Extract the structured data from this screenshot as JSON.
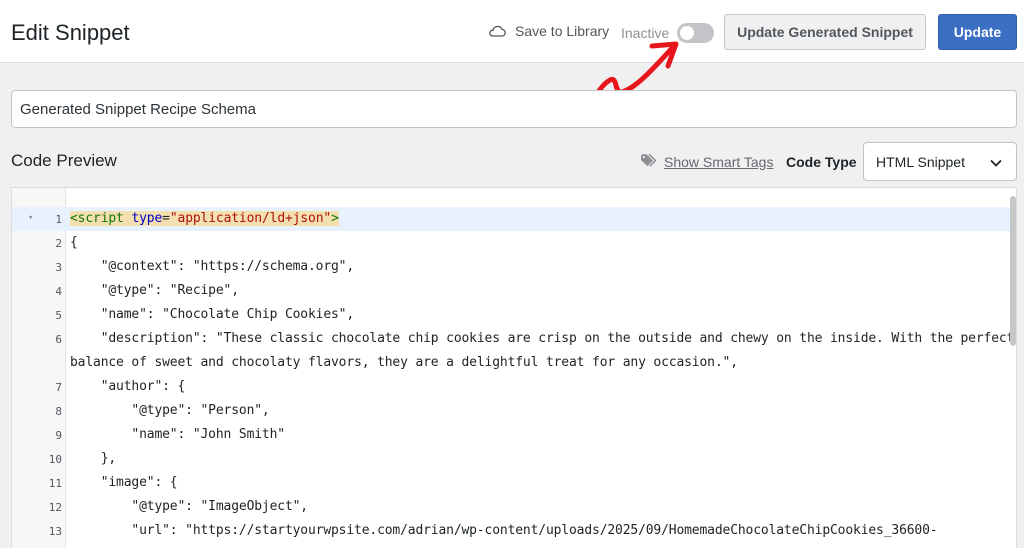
{
  "header": {
    "title": "Edit Snippet",
    "save_to_library": "Save to Library",
    "status_label": "Inactive",
    "active": false,
    "generated_button": "Update Generated Snippet",
    "update_button": "Update"
  },
  "snippet_title": "Generated Snippet Recipe Schema",
  "code_preview": {
    "title": "Code Preview",
    "smart_tags_link": "Show Smart Tags",
    "code_type_label": "Code Type",
    "code_type_value": "HTML Snippet"
  },
  "code_lines": [
    {
      "no": "1",
      "text": "<script type=\"application/ld+json\">"
    },
    {
      "no": "2",
      "text": "{"
    },
    {
      "no": "3",
      "text": "    \"@context\": \"https://schema.org\","
    },
    {
      "no": "4",
      "text": "    \"@type\": \"Recipe\","
    },
    {
      "no": "5",
      "text": "    \"name\": \"Chocolate Chip Cookies\","
    },
    {
      "no": "6",
      "text": "    \"description\": \"These classic chocolate chip cookies are crisp on the outside and chewy on the inside. With the perfect"
    },
    {
      "no": "",
      "text": "balance of sweet and chocolaty flavors, they are a delightful treat for any occasion.\","
    },
    {
      "no": "7",
      "text": "    \"author\": {"
    },
    {
      "no": "8",
      "text": "        \"@type\": \"Person\","
    },
    {
      "no": "9",
      "text": "        \"name\": \"John Smith\""
    },
    {
      "no": "10",
      "text": "    },"
    },
    {
      "no": "11",
      "text": "    \"image\": {"
    },
    {
      "no": "12",
      "text": "        \"@type\": \"ImageObject\","
    },
    {
      "no": "13",
      "text": "        \"url\": \"https://startyourwpsite.com/adrian/wp-content/uploads/2025/09/HomemadeChocolateChipCookies_36600-"
    }
  ],
  "colors": {
    "primary": "#3c6ec4",
    "annotation_arrow": "#e8161c",
    "active_line": "#e8f2ff"
  }
}
